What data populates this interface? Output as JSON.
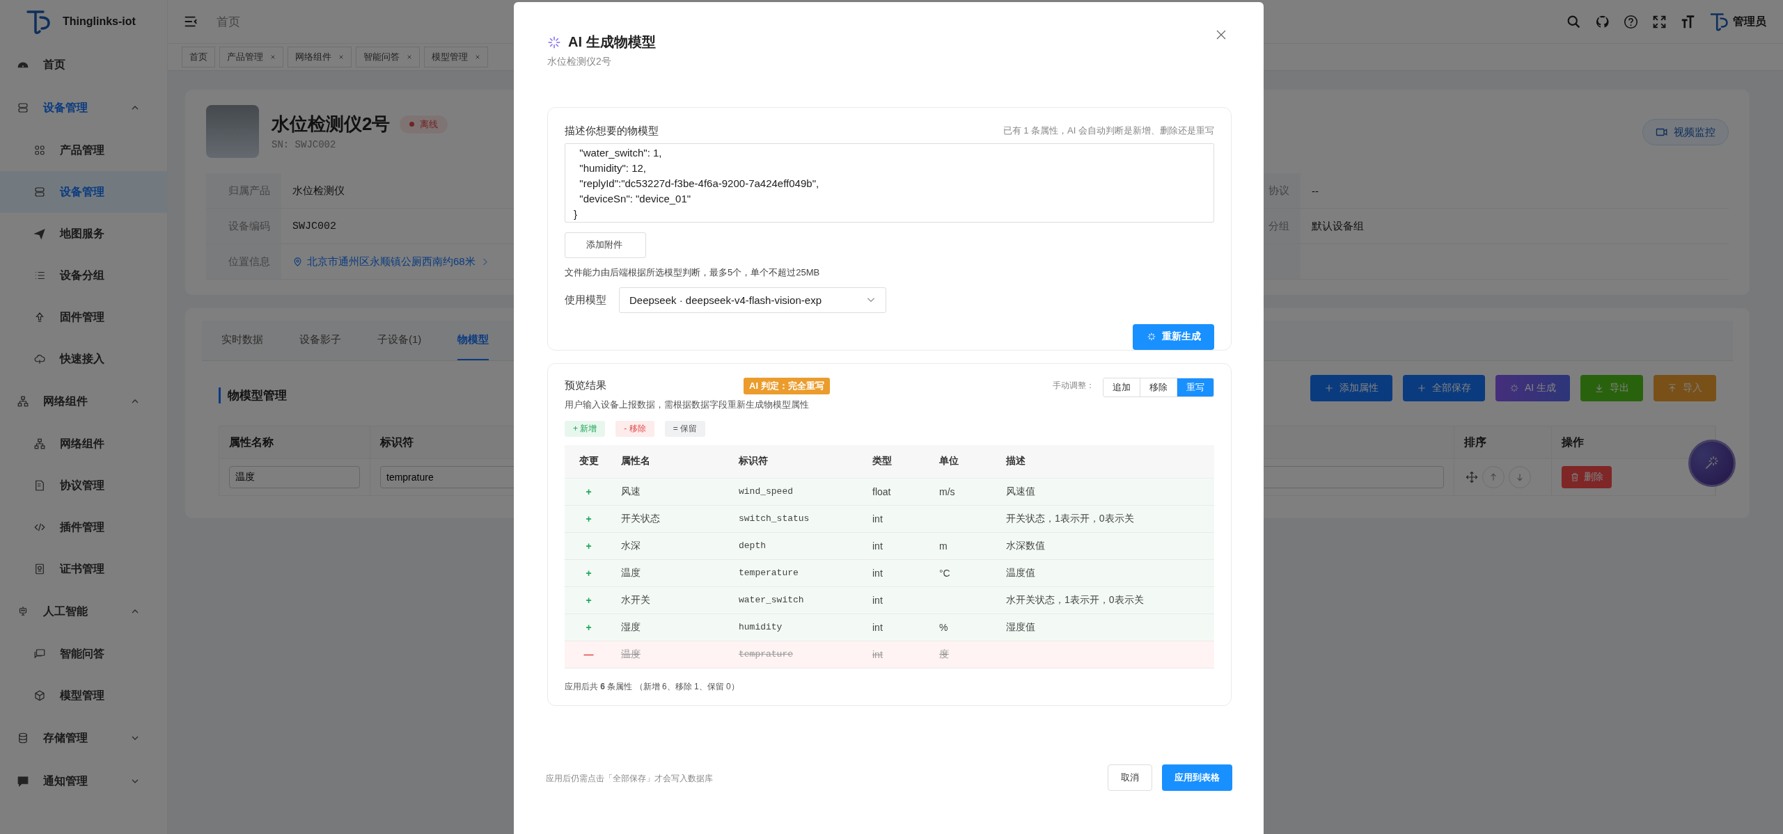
{
  "sidebar": {
    "brand": "Thinglinks-iot",
    "menu": [
      {
        "kind": "item",
        "label": "首页",
        "selected": false
      },
      {
        "kind": "group",
        "label": "设备管理",
        "active": true,
        "expanded": true,
        "children": [
          {
            "label": "产品管理",
            "selected": false
          },
          {
            "label": "设备管理",
            "selected": true
          },
          {
            "label": "地图服务",
            "selected": false
          },
          {
            "label": "设备分组",
            "selected": false
          },
          {
            "label": "固件管理",
            "selected": false
          },
          {
            "label": "快速接入",
            "selected": false
          }
        ]
      },
      {
        "kind": "group",
        "label": "网络组件",
        "active": false,
        "expanded": true,
        "children": [
          {
            "label": "网络组件",
            "selected": false
          },
          {
            "label": "协议管理",
            "selected": false
          },
          {
            "label": "插件管理",
            "selected": false
          },
          {
            "label": "证书管理",
            "selected": false
          }
        ]
      },
      {
        "kind": "group",
        "label": "人工智能",
        "active": false,
        "expanded": true,
        "children": [
          {
            "label": "智能问答",
            "selected": false
          },
          {
            "label": "模型管理",
            "selected": false
          }
        ]
      },
      {
        "kind": "group",
        "label": "存储管理",
        "active": false,
        "expanded": false
      },
      {
        "kind": "group",
        "label": "通知管理",
        "active": false,
        "expanded": false
      }
    ]
  },
  "header": {
    "breadcrumb": "首页",
    "user": "管理员"
  },
  "tags": [
    {
      "label": "首页",
      "closable": false
    },
    {
      "label": "产品管理",
      "closable": true
    },
    {
      "label": "网络组件",
      "closable": true
    },
    {
      "label": "智能问答",
      "closable": true
    },
    {
      "label": "模型管理",
      "closable": true
    }
  ],
  "device": {
    "name": "水位检测仪2号",
    "status": "离线",
    "online": false,
    "sn": "SN: SWJC002",
    "video_button": "视频监控",
    "fields": [
      {
        "label": "归属产品",
        "value": "水位检测仪",
        "kind": "text"
      },
      {
        "label": "协议",
        "value": "--",
        "kind": "text"
      },
      {
        "label": "设备编码",
        "value": "SWJC002",
        "kind": "code"
      },
      {
        "label": "分组",
        "value": "默认设备组",
        "kind": "text"
      },
      {
        "label": "位置信息",
        "value": "北京市通州区永顺镇公厕西南约68米",
        "kind": "location"
      }
    ]
  },
  "detail_tabs": [
    {
      "label": "实时数据",
      "selected": false
    },
    {
      "label": "设备影子",
      "selected": false
    },
    {
      "label": "子设备(1)",
      "selected": false
    },
    {
      "label": "物模型",
      "selected": true
    }
  ],
  "model_panel": {
    "title": "物模型管理",
    "buttons": [
      {
        "label": "添加属性",
        "kind": "add"
      },
      {
        "label": "全部保存",
        "kind": "save"
      },
      {
        "label": "AI 生成",
        "kind": "ai"
      },
      {
        "label": "导出",
        "kind": "export"
      },
      {
        "label": "导入",
        "kind": "import"
      }
    ],
    "name_column": "属性名称",
    "identifier_column": "标识符",
    "sort_column": "排序",
    "action_column": "操作",
    "rows": [
      {
        "name": "温度",
        "identifier": "temprature",
        "action": "删除"
      }
    ]
  },
  "modal": {
    "title": "AI 生成物模型",
    "subtitle": "水位检测仪2号",
    "prompt": {
      "label": "描述你想要的物模型",
      "hint": "已有 1 条属性，AI 会自动判断是新增、删除还是重写",
      "lines": [
        "  \"water_switch\": 1,",
        "  \"humidity\": 12,",
        "  \"replyId\":\"dc53227d-f3be-4f6a-9200-7a424eff049b\",",
        "  \"deviceSn\": \"device_01\"",
        "}"
      ]
    },
    "attach_button": "添加附件",
    "file_hint": "文件能力由后端根据所选模型判断，最多5个，单个不超过25MB",
    "model_select": {
      "label": "使用模型",
      "value": "Deepseek · deepseek-v4-flash-vision-exp"
    },
    "regenerate_button": "重新生成",
    "preview": {
      "title": "预览结果",
      "verdict": "AI 判定：完全重写",
      "summary": "用户输入设备上报数据，需根据数据字段重新生成物模型属性",
      "adjust_label": "手动调整：",
      "adjust_options": [
        {
          "label": "追加",
          "selected": false
        },
        {
          "label": "移除",
          "selected": false
        },
        {
          "label": "重写",
          "selected": true
        }
      ],
      "legend": [
        {
          "kind": "add",
          "label": "+ 新增"
        },
        {
          "kind": "remove",
          "label": "- 移除"
        },
        {
          "kind": "keep",
          "label": "= 保留"
        }
      ],
      "columns": [
        "变更",
        "属性名",
        "标识符",
        "类型",
        "单位",
        "描述"
      ],
      "rows": [
        {
          "kind": "add",
          "mark": "+",
          "name": "风速",
          "identifier": "wind_speed",
          "type": "float",
          "unit": "m/s",
          "description": "风速值"
        },
        {
          "kind": "add",
          "mark": "+",
          "name": "开关状态",
          "identifier": "switch_status",
          "type": "int",
          "description": "开关状态，1表示开，0表示关"
        },
        {
          "kind": "add",
          "mark": "+",
          "name": "水深",
          "identifier": "depth",
          "type": "int",
          "unit": "m",
          "description": "水深数值"
        },
        {
          "kind": "add",
          "mark": "+",
          "name": "温度",
          "identifier": "temperature",
          "type": "int",
          "unit": "°C",
          "description": "温度值"
        },
        {
          "kind": "add",
          "mark": "+",
          "name": "水开关",
          "identifier": "water_switch",
          "type": "int",
          "description": "水开关状态，1表示开，0表示关"
        },
        {
          "kind": "add",
          "mark": "+",
          "name": "湿度",
          "identifier": "humidity",
          "type": "int",
          "unit": "%",
          "description": "湿度值"
        },
        {
          "kind": "remove",
          "mark": "—",
          "name": "温度",
          "identifier": "temprature",
          "type": "int",
          "unit": "度"
        }
      ],
      "total": "应用后共 **6** 条属性 （新增 6、移除 1、保留 0）"
    },
    "footer_note": "应用后仍需点击「全部保存」才会写入数据库",
    "buttons": [
      {
        "label": "取消",
        "kind": "default"
      },
      {
        "label": "应用到表格",
        "kind": "primary"
      }
    ]
  }
}
